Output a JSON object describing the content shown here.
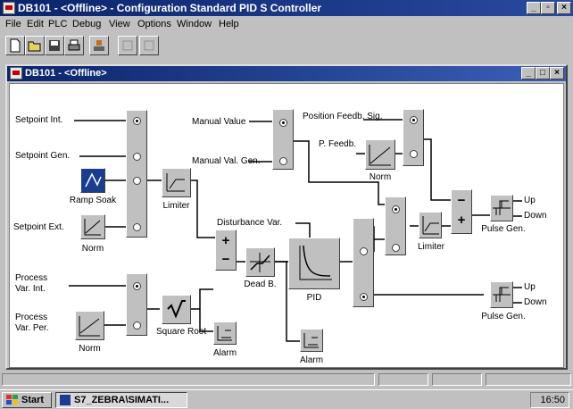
{
  "window": {
    "title": "DB101 - <Offline> - Configuration Standard PID S Controller"
  },
  "menu": [
    "File",
    "Edit",
    "PLC",
    "Debug",
    "View",
    "Options",
    "Window",
    "Help"
  ],
  "toolbar": {
    "icons": [
      "new-icon",
      "open-icon",
      "save-icon",
      "print-icon",
      "load-icon",
      "disabled-icon-1",
      "disabled-icon-2"
    ]
  },
  "inner_window": {
    "title": "DB101 - <Offline>"
  },
  "diagram": {
    "labels": {
      "setpoint_int": "Setpoint Int.",
      "setpoint_gen": "Setpoint Gen.",
      "setpoint_ext": "Setpoint Ext.",
      "process_var_int": "Process Var. Int.",
      "process_var_per": "Process Var. Per.",
      "manual_value": "Manual Value",
      "manual_val_gen": "Manual Val. Gen.",
      "position_feedb_sig": "Position Feedb. Sig.",
      "p_feedb": "P. Feedb.",
      "disturbance_var": "Disturbance Var."
    },
    "blocks": {
      "ramp_soak": "Ramp Soak",
      "norm1": "Norm",
      "norm2": "Norm",
      "norm3": "Norm",
      "limiter1": "Limiter",
      "limiter2": "Limiter",
      "square_root": "Square Root",
      "alarm1": "Alarm",
      "alarm2": "Alarm",
      "dead_b": "Dead B.",
      "pid": "PID",
      "pulse_gen1": "Pulse Gen.",
      "pulse_gen2": "Pulse Gen."
    },
    "outputs": {
      "up1": "Up",
      "down1": "Down",
      "up2": "Up",
      "down2": "Down"
    },
    "signs": {
      "plus": "+",
      "minus": "−"
    }
  },
  "taskbar": {
    "start_label": "Start",
    "task_label": "S7_ZEBRA\\SIMATI...",
    "clock": "16:50"
  }
}
